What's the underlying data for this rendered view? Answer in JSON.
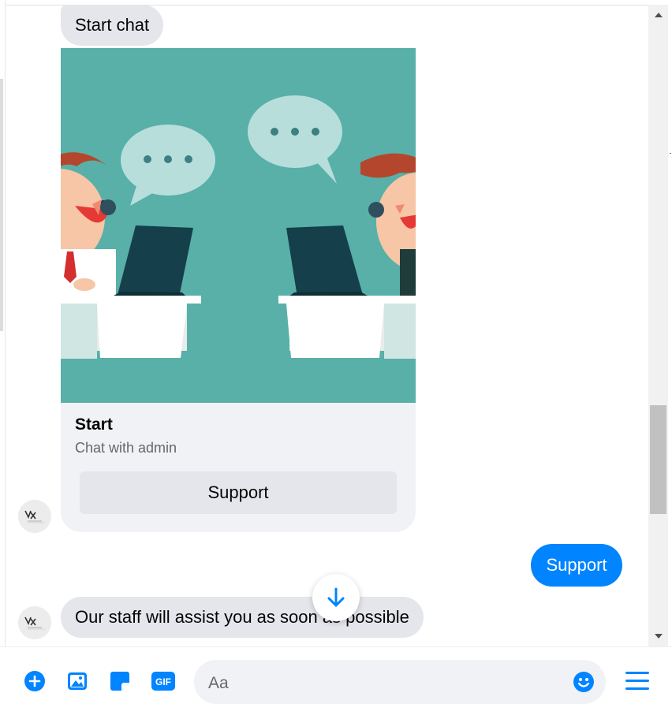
{
  "conversation": {
    "start_message": "Start chat",
    "card": {
      "title": "Start",
      "subtitle": "Chat with admin",
      "button_label": "Support",
      "image": "customer-support-illustration"
    },
    "user_reply": "Support",
    "staff_message": "Our staff will assist you as soon as possible"
  },
  "composer": {
    "placeholder": "Aa",
    "tools": [
      "plus-icon",
      "image-icon",
      "sticker-icon",
      "gif-icon"
    ],
    "gif_label": "GIF"
  },
  "colors": {
    "accent": "#0084ff",
    "incoming_bubble": "#e4e6eb",
    "card_background": "#f0f2f5",
    "image_background": "#58b0a8"
  }
}
